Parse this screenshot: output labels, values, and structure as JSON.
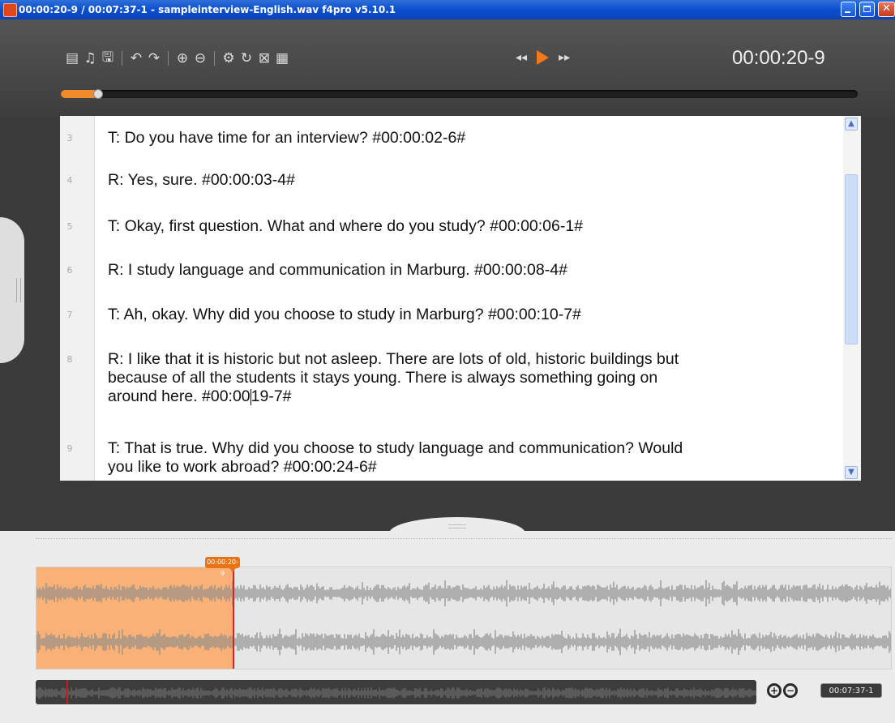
{
  "window": {
    "title": "00:00:20-9 / 00:07:37-1 - sampleinterview-English.wav f4pro v5.10.1",
    "controls": [
      "minimize-icon",
      "maximize-icon",
      "close-icon"
    ]
  },
  "toolbar": {
    "icons": [
      "document-icon",
      "music-note-icon",
      "save-icon",
      "undo-icon",
      "redo-icon",
      "zoom-in-icon",
      "zoom-out-icon",
      "settings-icon",
      "refresh-icon",
      "fullscreen-icon",
      "video-icon"
    ]
  },
  "transport": {
    "rewind_icon": "rewind-icon",
    "play_icon": "play-icon",
    "forward_icon": "fast-forward-icon",
    "timecode": "00:00:20-9",
    "progress": 0.047
  },
  "transcript": {
    "lines": [
      {
        "num": "3",
        "text": "T: Do you have time for an interview? #00:00:02-6#"
      },
      {
        "num": "4",
        "text": "R: Yes, sure. #00:00:03-4#"
      },
      {
        "num": "5",
        "text": "T: Okay, first question. What and where do you study?  #00:00:06-1#"
      },
      {
        "num": "6",
        "text": "R: I study language and communication in Marburg. #00:00:08-4#"
      },
      {
        "num": "7",
        "text": "T: Ah, okay. Why did you choose to study in Marburg? #00:00:10-7#"
      },
      {
        "num": "8",
        "text_lines": [
          "R: I like that it is historic but not asleep. There are lots of old, historic buildings but",
          "because of all the students it stays young. There is always something going on"
        ],
        "text_last_before_caret": "around here. #00:00",
        "text_last_after_caret": "19-7#"
      },
      {
        "num": "9",
        "text_lines": [
          "T: That is true. Why did you choose to study language and communication? Would",
          "you like to work abroad? #00:00:24-6#"
        ]
      }
    ]
  },
  "waveform": {
    "cursor_label": "00:00:20-9",
    "selection_fraction": 0.23,
    "end_time": "00:07:37-1",
    "overview_position": 0.043
  }
}
